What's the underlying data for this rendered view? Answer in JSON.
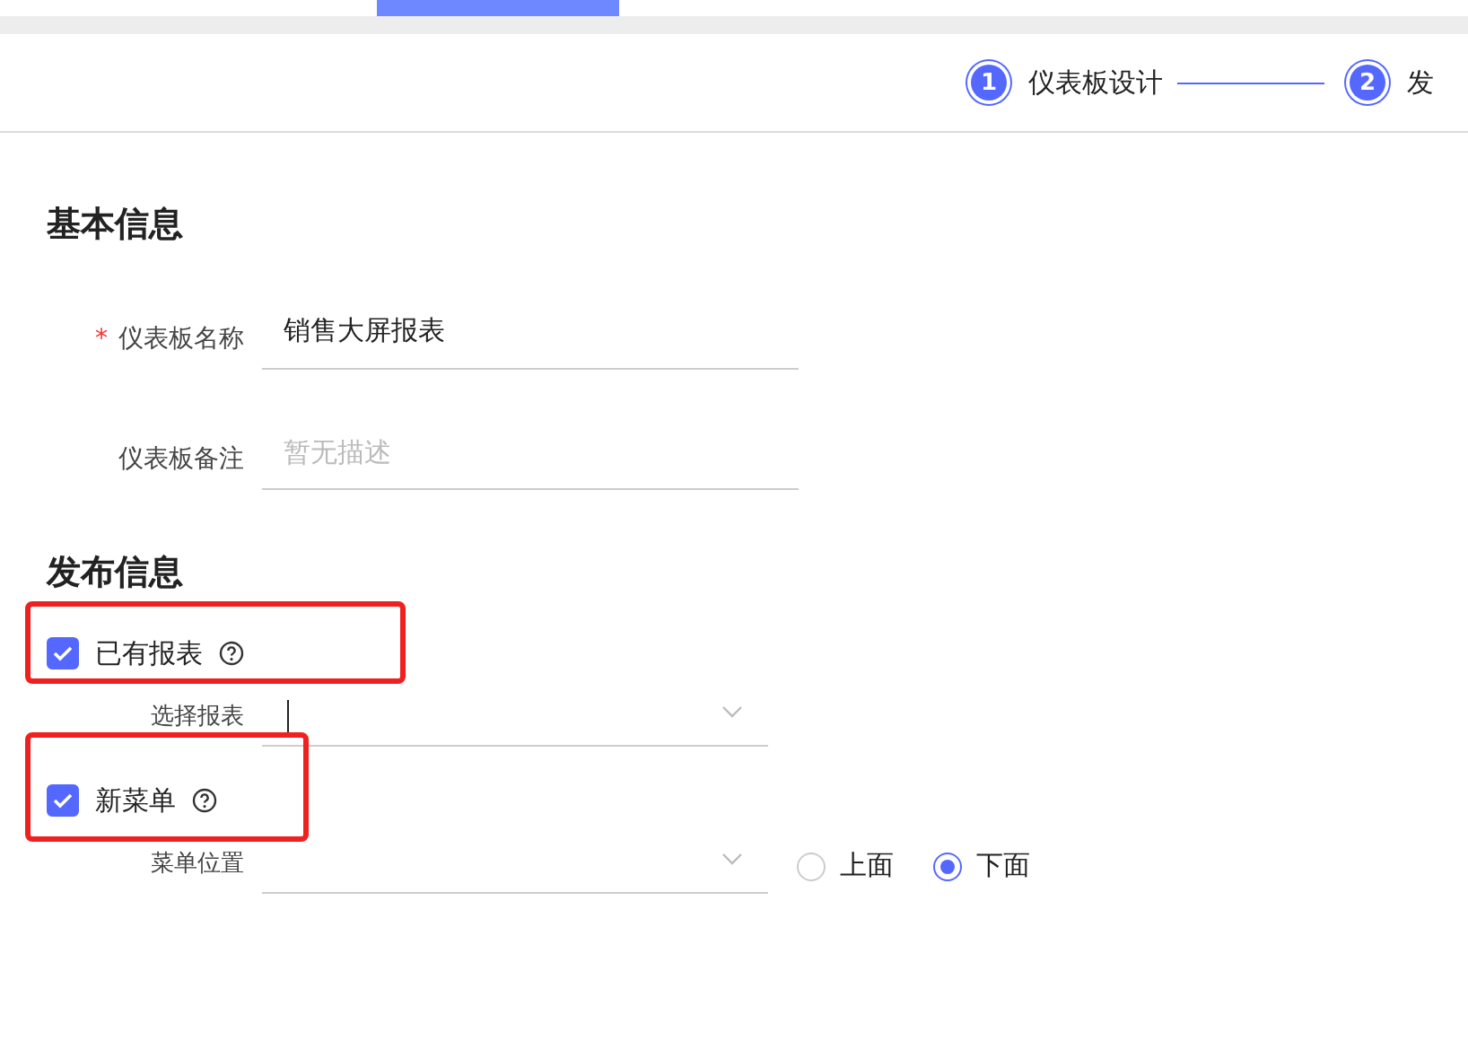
{
  "steps": [
    {
      "number": "1",
      "label": "仪表板设计",
      "active": true
    },
    {
      "number": "2",
      "label": "发",
      "active": true
    }
  ],
  "sections": [
    {
      "title": "基本信息",
      "fields": [
        {
          "label": "仪表板名称",
          "required_mark": "*",
          "value": "销售大屏报表"
        },
        {
          "label": "仪表板备注",
          "placeholder": "暂无描述"
        }
      ]
    },
    {
      "title": "发布信息"
    }
  ],
  "options": [
    {
      "label": "已有报表",
      "checked": true,
      "highlighted": true,
      "select": {
        "label": "选择报表",
        "focused": true
      }
    },
    {
      "label": "新菜单",
      "checked": true,
      "highlighted": true,
      "select": {
        "label": "菜单位置",
        "focused": false
      },
      "radios": [
        {
          "label": "上面",
          "selected": false
        },
        {
          "label": "下面",
          "selected": true
        }
      ]
    }
  ]
}
